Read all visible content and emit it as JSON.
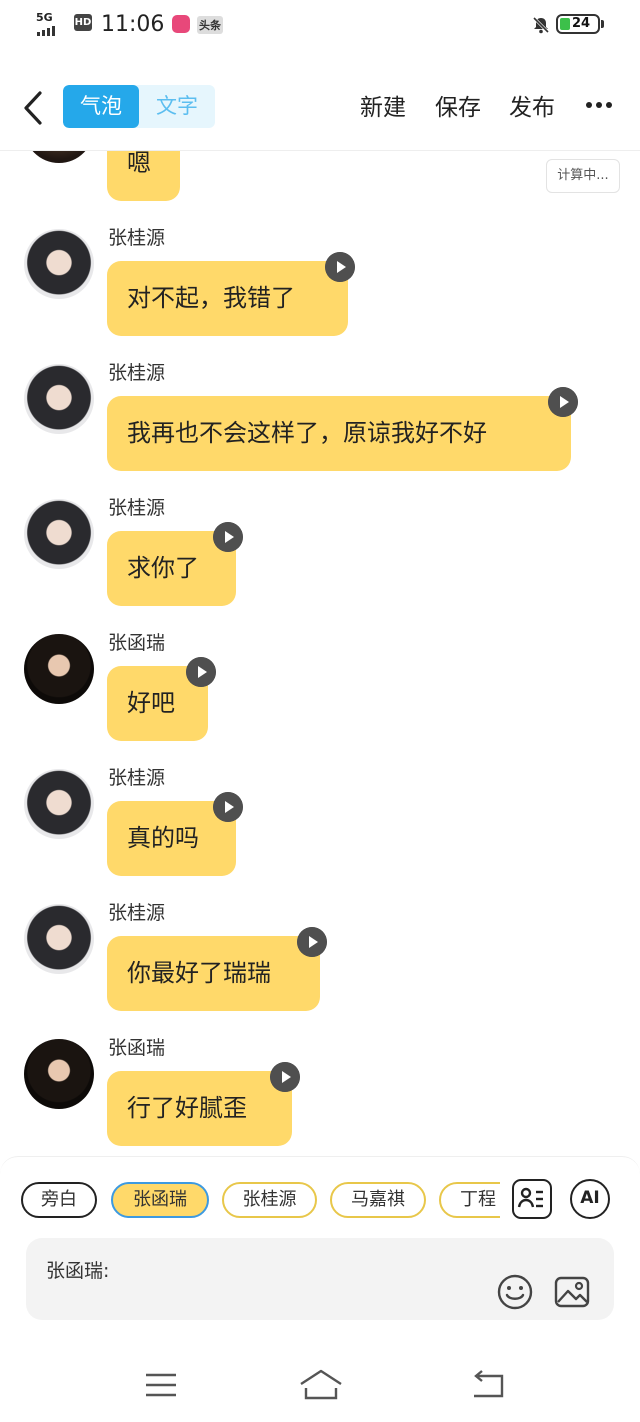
{
  "status_bar": {
    "network": "5G",
    "hd": "HD",
    "time": "11:06",
    "app_badge": "头条",
    "battery": "24"
  },
  "toolbar": {
    "tab_bubble": "气泡",
    "tab_text": "文字",
    "new_label": "新建",
    "save_label": "保存",
    "publish_label": "发布"
  },
  "chat": {
    "calculating": "计算中...",
    "partial_message": "嗯",
    "messages": [
      {
        "name": "张桂源",
        "text": "对不起，我错了"
      },
      {
        "name": "张桂源",
        "text": "我再也不会这样了，原谅我好不好"
      },
      {
        "name": "张桂源",
        "text": "求你了"
      },
      {
        "name": "张函瑞",
        "text": "好吧"
      },
      {
        "name": "张桂源",
        "text": "真的吗"
      },
      {
        "name": "张桂源",
        "text": "你最好了瑞瑞"
      },
      {
        "name": "张函瑞",
        "text": "行了好腻歪"
      }
    ]
  },
  "role_bar": {
    "roles": [
      "旁白",
      "张函瑞",
      "张桂源",
      "马嘉祺",
      "丁程"
    ],
    "selected": "张函瑞",
    "ai_label": "AI"
  },
  "input": {
    "label": "张函瑞:"
  },
  "colors": {
    "bubble": "#ffd96a",
    "accent": "#25a8ea",
    "chip_border": "#e8c74a"
  }
}
